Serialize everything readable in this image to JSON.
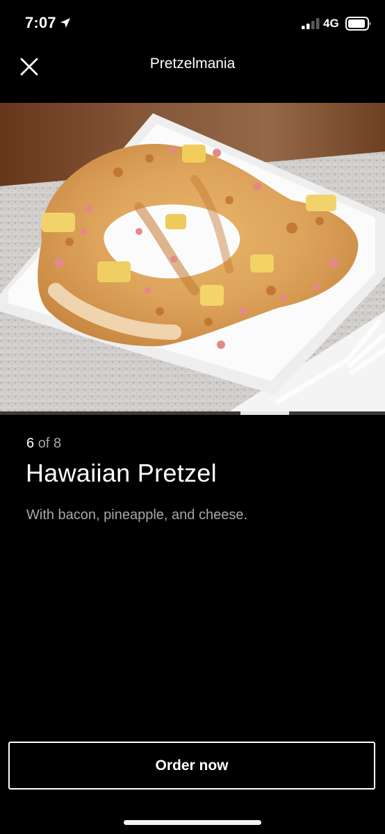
{
  "status_bar": {
    "time": "7:07",
    "network": "4G"
  },
  "header": {
    "title": "Pretzelmania",
    "close_icon": "close-icon"
  },
  "photo": {
    "alt": "Hawaiian Pretzel photo"
  },
  "gallery": {
    "current": "6",
    "of_label": "of",
    "total": "8",
    "position": 6,
    "count": 8
  },
  "item": {
    "title": "Hawaiian Pretzel",
    "description": "With bacon, pineapple, and cheese."
  },
  "actions": {
    "order_label": "Order now"
  },
  "colors": {
    "background": "#000000",
    "text_primary": "#ffffff",
    "text_secondary": "#a8a8a8"
  }
}
